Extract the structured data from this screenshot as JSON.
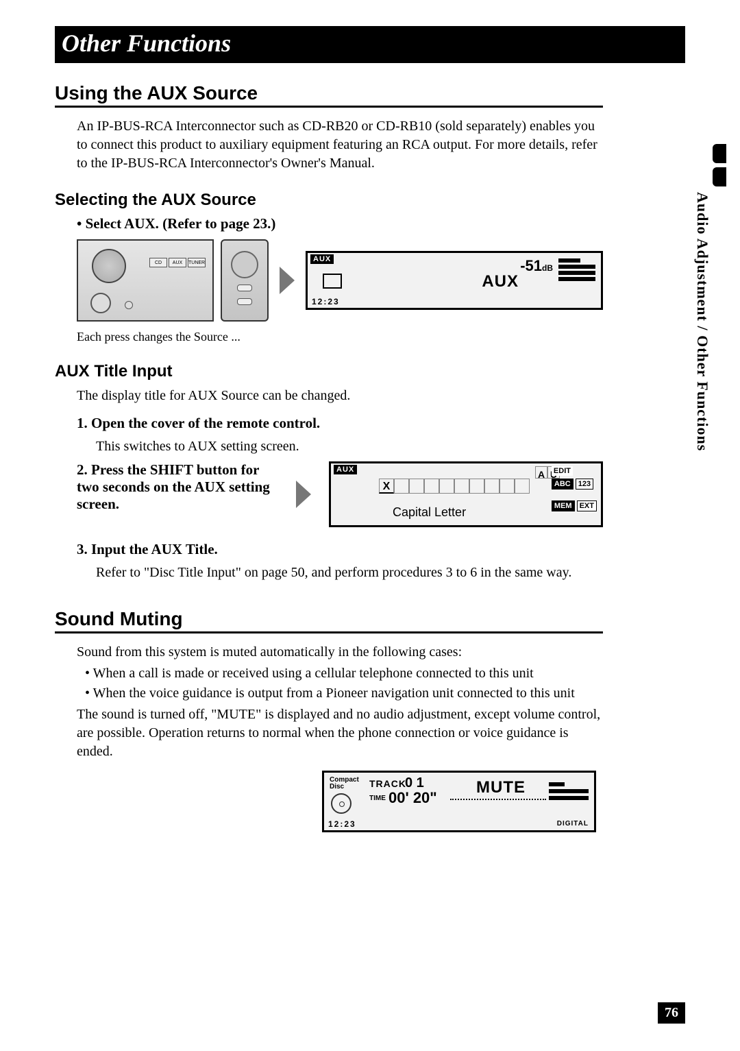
{
  "chapter_title": "Other Functions",
  "side_label": "Audio Adjustment / Other Functions",
  "page_number": "76",
  "aux": {
    "heading": "Using the AUX Source",
    "intro": "An IP-BUS-RCA Interconnector such as CD-RB20 or CD-RB10 (sold separately) enables you to connect this product to auxiliary equipment featuring an RCA output. For more details, refer to the IP-BUS-RCA Interconnector's Owner's Manual.",
    "select_heading": "Selecting the AUX Source",
    "select_step": "• Select AUX. (Refer to page 23.)",
    "select_note": "Each press changes the Source ...",
    "panel_btns": [
      "CD",
      "AUX",
      "TUNER"
    ],
    "lcd": {
      "label": "AUX",
      "db": "-51",
      "db_unit": "dB",
      "aux_text": "AUX",
      "time": "12:23"
    },
    "title_heading": "AUX Title Input",
    "title_intro": "The display title for AUX Source can be changed.",
    "step1": "1. Open the cover of the remote control.",
    "step1_note": "This switches to AUX setting screen.",
    "step2": "2. Press the SHIFT button for two seconds on the AUX setting screen.",
    "edit_lcd": {
      "label": "AUX",
      "au": [
        "A",
        "U"
      ],
      "grid_first": "X",
      "caption": "Capital Letter",
      "tags": {
        "edit": "EDIT",
        "abc": "ABC",
        "num": "123",
        "mem": "MEM",
        "ext": "EXT"
      }
    },
    "step3": "3. Input the AUX Title.",
    "step3_note": "Refer to \"Disc Title Input\" on page 50, and perform procedures 3 to 6 in the same way."
  },
  "mute": {
    "heading": "Sound Muting",
    "intro": "Sound from this system is muted automatically in the following cases:",
    "b1": "• When a call is made or received using a cellular telephone connected to this unit",
    "b2": "• When the voice guidance is output from a Pioneer navigation unit connected to this unit",
    "outro": "The sound is turned off, \"MUTE\" is displayed and no audio adjustment, except volume control, are possible. Operation returns to normal when the phone connection or voice guidance is ended.",
    "lcd": {
      "cd_line1": "Compact",
      "cd_line2": "Disc",
      "track_label": "TRACK",
      "track_no": "0 1",
      "time_label": "TIME",
      "time_val": "00' 20\"",
      "mute": "MUTE",
      "digital": "DIGITAL",
      "clock": "12:23"
    }
  }
}
